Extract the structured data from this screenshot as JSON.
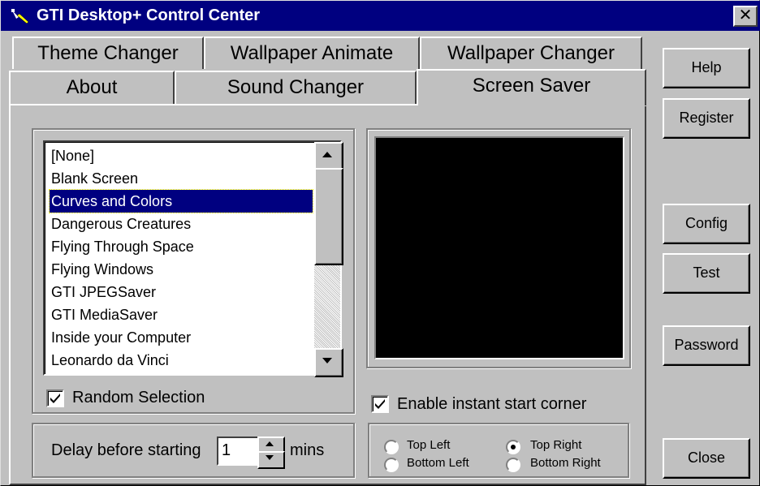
{
  "window": {
    "title": "GTI Desktop+ Control Center",
    "close_glyph": "✕"
  },
  "tabs": {
    "row1": [
      "Theme Changer",
      "Wallpaper Animate",
      "Wallpaper Changer"
    ],
    "row2": [
      "About",
      "Sound Changer",
      "Screen Saver"
    ],
    "active": "Screen Saver"
  },
  "screensaver_list": {
    "items": [
      "[None]",
      "Blank Screen",
      "Curves and Colors",
      "Dangerous Creatures",
      "Flying Through Space",
      "Flying Windows",
      "GTI JPEGSaver",
      "GTI MediaSaver",
      "Inside your Computer",
      "Leonardo da Vinci"
    ],
    "selected": "Curves and Colors"
  },
  "random_selection": {
    "label": "Random Selection",
    "checked": true
  },
  "instant_corner": {
    "label": "Enable instant start corner",
    "checked": true
  },
  "corners": {
    "top_left": "Top Left",
    "top_right": "Top Right",
    "bottom_left": "Bottom Left",
    "bottom_right": "Bottom Right",
    "selected": "Top Right"
  },
  "delay": {
    "label": "Delay before starting",
    "value": "1",
    "unit": "mins"
  },
  "buttons": {
    "help": "Help",
    "register": "Register",
    "config": "Config",
    "test": "Test",
    "password": "Password",
    "close": "Close"
  },
  "colors": {
    "title_bar": "#000080",
    "face": "#c0c0c0",
    "selection": "#000080",
    "preview": "#000000"
  }
}
